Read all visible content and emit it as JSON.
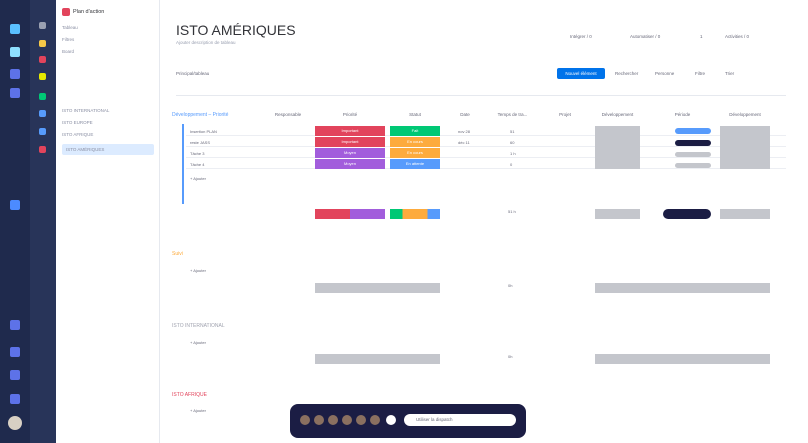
{
  "app": {
    "workspace_name": "Plan d'action",
    "board_title": "ISTO AMÉRIQUES",
    "board_description": "Ajouter description de tableau"
  },
  "sidebar": {
    "items": [
      "Tableau",
      "Filtres",
      "Board",
      "ISTO INTERNATIONAL",
      "ISTO EUROPE",
      "ISTO AFRIQUE",
      "ISTO AMÉRIQUES"
    ]
  },
  "header": {
    "integrate": "Intégrer / 0",
    "automate": "Automatiser / 0",
    "members": "1",
    "activity": "Activities / 0",
    "view": "Principal/tableau",
    "new_item": "Nouvel élément",
    "search": "Rechercher",
    "person": "Personne",
    "filter": "Filtre",
    "sort": "Trier"
  },
  "columns": [
    "Responsable",
    "Priorité",
    "Statut",
    "Date",
    "Temps de tra...",
    "Projet",
    "Développement",
    "Période",
    "Développement"
  ],
  "groups": [
    {
      "name": "Développement – Priorité",
      "color": "#579bfc",
      "rows": [
        {
          "name": "Insertion PLAN",
          "priority": "Important",
          "priority_color": "#e2445c",
          "status": "Fait",
          "status_color": "#00c875",
          "date": "nov 28",
          "time": "51"
        },
        {
          "name": "reste JASS",
          "priority": "Important",
          "priority_color": "#e2445c",
          "status": "En cours",
          "status_color": "#fdab3d",
          "date": "déc 11",
          "time": "60"
        },
        {
          "name": "Tâche 3",
          "priority": "Moyen",
          "priority_color": "#a25ddc",
          "status": "En cours",
          "status_color": "#fdab3d",
          "date": "",
          "time": "1 h"
        },
        {
          "name": "Tâche 4",
          "priority": "Moyen",
          "priority_color": "#a25ddc",
          "status": "En attente",
          "status_color": "#579bfc",
          "date": "",
          "time": "0"
        }
      ],
      "add": "+ Ajouter",
      "sum": "51 h"
    },
    {
      "name": "Suivi",
      "color": "#fdab3d",
      "add": "+ Ajouter",
      "sum": "0h"
    },
    {
      "name": "ISTO INTERNATIONAL",
      "color": "#a0a3af",
      "add": "+ Ajouter",
      "sum": "0h"
    },
    {
      "name": "ISTO AFRIQUE",
      "color": "#e2445c",
      "add": "+ Ajouter",
      "sum": ""
    }
  ],
  "dock": {
    "search_placeholder": "Utiliser la dispatch"
  }
}
